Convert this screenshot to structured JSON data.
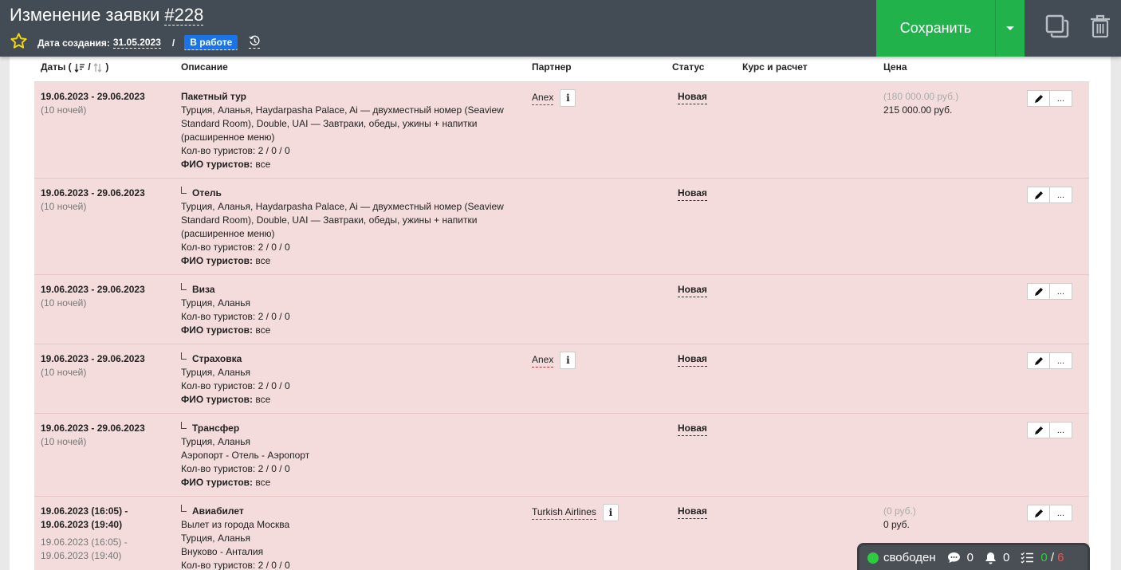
{
  "header": {
    "title_prefix": "Изменение заявки ",
    "title_number": "#228",
    "created_label": "Дата создания:",
    "created_date": "31.05.2023",
    "slash": "/",
    "status_badge": "В работе",
    "save_label": "Сохранить"
  },
  "table": {
    "columns": {
      "dates": "Даты (",
      "dates_end": ")",
      "dates_sep": "/",
      "description": "Описание",
      "partner": "Партнер",
      "status": "Статус",
      "rate": "Курс и расчет",
      "price": "Цена"
    },
    "rows": [
      {
        "date": "19.06.2023 - 29.06.2023",
        "nights": "(10 ночей)",
        "service": "Пакетный тур",
        "lines": [
          "Турция, Аланья, Haydarpasha Palace, Ai — двухместный номер (Seaview Standard Room), Double, UAI — Завтраки, обеды, ужины + напитки (расширенное меню)",
          "Кол-во туристов: 2 / 0 / 0"
        ],
        "fio_label": "ФИО туристов:",
        "fio": "все",
        "partner": "Anex",
        "status": "Новая",
        "price_old": "(180 000.00 руб.)",
        "price": "215 000.00 руб."
      },
      {
        "date": "19.06.2023 - 29.06.2023",
        "nights": "(10 ночей)",
        "service": "Отель",
        "lines": [
          "Турция, Аланья, Haydarpasha Palace, Ai — двухместный номер (Seaview Standard Room), Double, UAI — Завтраки, обеды, ужины + напитки (расширенное меню)",
          "Кол-во туристов: 2 / 0 / 0"
        ],
        "fio_label": "ФИО туристов:",
        "fio": "все",
        "partner": "",
        "status": "Новая",
        "price_old": "",
        "price": ""
      },
      {
        "date": "19.06.2023 - 29.06.2023",
        "nights": "(10 ночей)",
        "service": "Виза",
        "lines": [
          "Турция, Аланья",
          "Кол-во туристов: 2 / 0 / 0"
        ],
        "fio_label": "ФИО туристов:",
        "fio": "все",
        "partner": "",
        "status": "Новая",
        "price_old": "",
        "price": ""
      },
      {
        "date": "19.06.2023 - 29.06.2023",
        "nights": "(10 ночей)",
        "service": "Страховка",
        "lines": [
          "Турция, Аланья",
          "Кол-во туристов: 2 / 0 / 0"
        ],
        "fio_label": "ФИО туристов:",
        "fio": "все",
        "partner": "Anex",
        "status": "Новая",
        "price_old": "",
        "price": ""
      },
      {
        "date": "19.06.2023 - 29.06.2023",
        "nights": "(10 ночей)",
        "service": "Трансфер",
        "lines": [
          "Турция, Аланья",
          "Аэропорт - Отель - Аэропорт",
          "Кол-во туристов: 2 / 0 / 0"
        ],
        "fio_label": "ФИО туристов:",
        "fio": "все",
        "partner": "",
        "status": "Новая",
        "price_old": "",
        "price": ""
      },
      {
        "date": "19.06.2023 (16:05) -",
        "date2": "19.06.2023 (19:40)",
        "nights": "19.06.2023 (16:05) -",
        "nights2": "19.06.2023 (19:40)",
        "service": "Авиабилет",
        "lines": [
          "Вылет из города Москва",
          "Турция, Аланья",
          "Внуково - Анталия",
          "Кол-во туристов: 2 / 0 / 0"
        ],
        "partner": "Turkish Airlines",
        "status": "Новая",
        "price_old": "(0 руб.)",
        "price": "0 руб."
      }
    ],
    "info_glyph": "i",
    "edit_icon": "pencil-icon",
    "more_label": "..."
  },
  "statusbar": {
    "status": "свободен",
    "messages": "0",
    "notifications": "0",
    "tasks_done": "0",
    "tasks_sep": "/",
    "tasks_total": "6"
  },
  "colors": {
    "header_bg": "#434b54",
    "save_green": "#22b24c",
    "row_bg": "#f4dcdc",
    "badge_blue": "#1a73e8"
  }
}
